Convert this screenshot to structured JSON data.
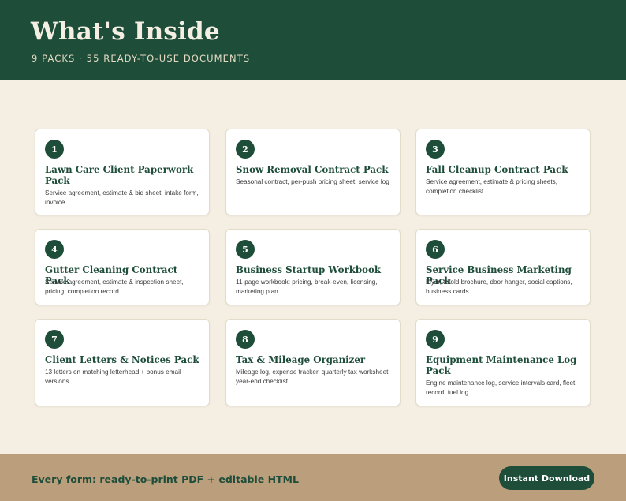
{
  "header": {
    "title": "What's Inside",
    "subtitle": "9 PACKS · 55 READY-TO-USE DOCUMENTS"
  },
  "packs": [
    {
      "number": "1",
      "title": "Lawn Care Client Paperwork Pack",
      "description": "Service agreement, estimate & bid sheet, intake form, invoice"
    },
    {
      "number": "2",
      "title": "Snow Removal Contract Pack",
      "description": "Seasonal contract, per-push pricing sheet, service log"
    },
    {
      "number": "3",
      "title": "Fall Cleanup Contract Pack",
      "description": "Service agreement, estimate & pricing sheets, completion checklist"
    },
    {
      "number": "4",
      "title": "Gutter Cleaning Contract Pack",
      "description": "Service agreement, estimate & inspection sheet, pricing, completion record"
    },
    {
      "number": "5",
      "title": "Business Startup Workbook",
      "description": "11-page workbook: pricing, break-even, licensing, marketing plan"
    },
    {
      "number": "6",
      "title": "Service Business Marketing Pack",
      "description": "Flyer, trifold brochure, door hanger, social captions, business cards"
    },
    {
      "number": "7",
      "title": "Client Letters & Notices Pack",
      "description": "13 letters on matching letterhead + bonus email versions"
    },
    {
      "number": "8",
      "title": "Tax & Mileage Organizer",
      "description": "Mileage log, expense tracker, quarterly tax worksheet, year-end checklist"
    },
    {
      "number": "9",
      "title": "Equipment Maintenance Log Pack",
      "description": "Engine maintenance log, service intervals card, fleet record, fuel log"
    }
  ],
  "footer": {
    "text": "Every form: ready-to-print PDF + editable HTML",
    "cta_label": "Instant Download"
  },
  "colors": {
    "primary": "#1e4d3a",
    "background": "#f5efe3",
    "footer": "#bb9f7c"
  }
}
